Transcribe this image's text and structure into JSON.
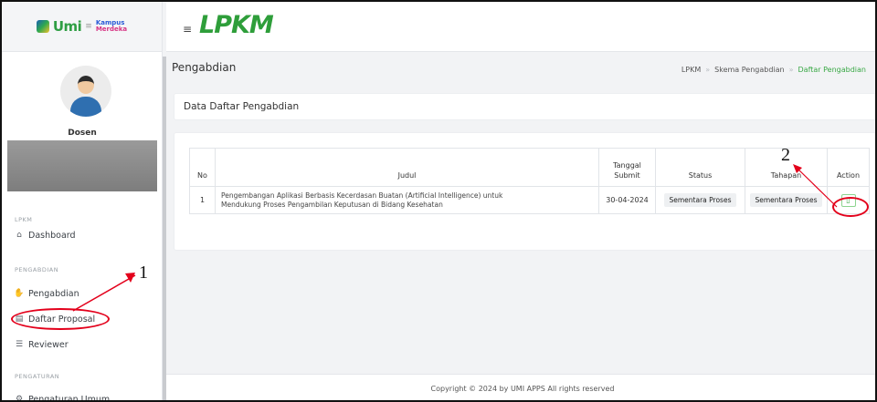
{
  "sidebar": {
    "logo": {
      "text": "Umi",
      "badge_line1": "Kampus",
      "badge_line2": "Merdeka"
    },
    "user": {
      "role": "Dosen"
    },
    "sections": [
      {
        "label": "LPKM",
        "items": [
          {
            "label": "Dashboard",
            "icon": "home-icon"
          }
        ]
      },
      {
        "label": "PENGABDIAN",
        "items": [
          {
            "label": "Pengabdian",
            "icon": "hand-icon"
          },
          {
            "label": "Daftar Proposal",
            "icon": "document-icon"
          },
          {
            "label": "Reviewer",
            "icon": "clipboard-icon"
          }
        ]
      },
      {
        "label": "PENGATURAN",
        "items": [
          {
            "label": "Pengaturan Umum",
            "icon": "gear-icon"
          }
        ]
      }
    ]
  },
  "topbar": {
    "brand": "LPKM",
    "menu_icon": "hamburger-icon"
  },
  "page": {
    "title": "Pengabdian",
    "breadcrumb": [
      "LPKM",
      "Skema Pengabdian",
      "Daftar Pengabdian"
    ]
  },
  "card_header": "Data Daftar Pengabdian",
  "table": {
    "headers": {
      "no": "No",
      "judul": "Judul",
      "tanggal_line1": "Tanggal",
      "tanggal_line2": "Submit",
      "status": "Status",
      "tahapan": "Tahapan",
      "action": "Action"
    },
    "rows": [
      {
        "no": "1",
        "judul_line1": "Pengembangan Aplikasi Berbasis Kecerdasan Buatan (Artificial Intelligence) untuk",
        "judul_line2": "Mendukung Proses Pengambilan Keputusan di Bidang Kesehatan",
        "tanggal": "30-04-2024",
        "status": "Sementara Proses",
        "tahapan": "Sementara Proses",
        "action_icon": "file-icon"
      }
    ]
  },
  "footer": "Copyright © 2024 by UMI APPS All rights reserved",
  "annotations": {
    "one": "1",
    "two": "2"
  },
  "colors": {
    "accent": "#39a845",
    "annotation": "#e3001b"
  }
}
